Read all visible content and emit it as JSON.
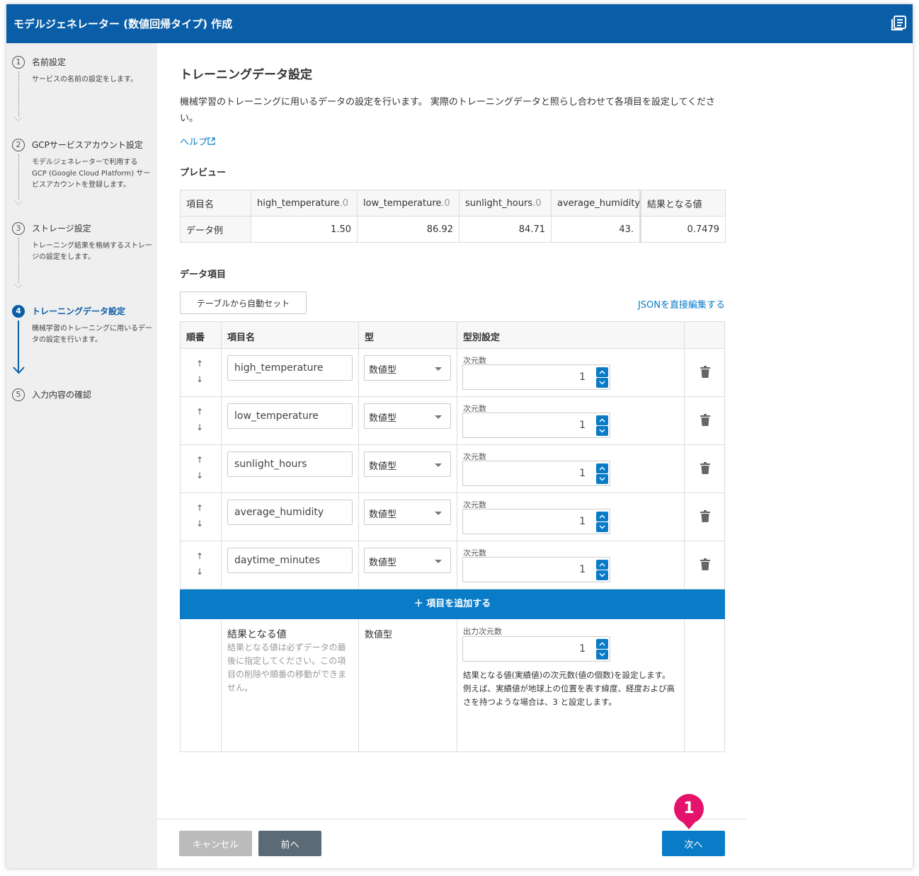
{
  "window": {
    "title": "モデルジェネレーター (数値回帰タイプ) 作成",
    "title_icon": "book-list-icon"
  },
  "sidebar": {
    "steps": [
      {
        "num": "1",
        "label": "名前設定",
        "desc": "サービスの名前の設定をします。",
        "state": "done"
      },
      {
        "num": "2",
        "label": "GCPサービスアカウント設定",
        "desc": "モデルジェネレーターで利用する GCP (Google Cloud Platform) サービスアカウントを登録します。",
        "state": "done"
      },
      {
        "num": "3",
        "label": "ストレージ設定",
        "desc": "トレーニング結果を格納するストレージの設定をします。",
        "state": "done"
      },
      {
        "num": "4",
        "label": "トレーニングデータ設定",
        "desc": "機械学習のトレーニングに用いるデータの設定を行います。",
        "state": "active"
      },
      {
        "num": "5",
        "label": "入力内容の確認",
        "desc": "",
        "state": "todo"
      }
    ]
  },
  "main": {
    "title": "トレーニングデータ設定",
    "intro": "機械学習のトレーニングに用いるデータの設定を行います。 実際のトレーニングデータと照らし合わせて各項目を設定してください。",
    "help_label": "ヘルプ",
    "preview_heading": "プレビュー",
    "preview": {
      "header_label": "項目名",
      "columns": [
        {
          "name": "high_temperature",
          "suffix": ".0"
        },
        {
          "name": "low_temperature",
          "suffix": ".0"
        },
        {
          "name": "sunlight_hours",
          "suffix": ".0"
        },
        {
          "name": "average_humidity",
          "suffix": ""
        },
        {
          "name": "結果となる値",
          "suffix": ""
        }
      ],
      "row_label": "データ例",
      "values": [
        "1.50",
        "86.92",
        "84.71",
        "43.",
        "0.7479"
      ]
    },
    "data_items_heading": "データ項目",
    "auto_set_label": "テーブルから自動セット",
    "json_edit_label": "JSONを直接編集する",
    "table": {
      "headers": {
        "order": "順番",
        "name": "項目名",
        "type": "型",
        "type_settings": "型別設定"
      },
      "dim_label": "次元数",
      "rows": [
        {
          "name": "high_temperature",
          "type": "数値型",
          "dim": "1"
        },
        {
          "name": "low_temperature",
          "type": "数値型",
          "dim": "1"
        },
        {
          "name": "sunlight_hours",
          "type": "数値型",
          "dim": "1"
        },
        {
          "name": "average_humidity",
          "type": "数値型",
          "dim": "1"
        },
        {
          "name": "daytime_minutes",
          "type": "数値型",
          "dim": "1"
        }
      ],
      "add_label": "＋ 項目を追加する",
      "result": {
        "title": "結果となる値",
        "desc": "結果となる値は必ずデータの最後に指定してください。この項目の削除や順番の移動ができません。",
        "type": "数値型",
        "out_dim_label": "出力次元数",
        "out_dim": "1",
        "note_1": "結果となる値(実績値)の次元数(値の個数)を設定します。",
        "note_2": "例えば、実績値が地球上の位置を表す緯度、経度および高さを持つような場合は、3 と設定します。"
      }
    },
    "buttons": {
      "cancel": "キャンセル",
      "prev": "前へ",
      "next": "次へ"
    },
    "callout": "1"
  },
  "colors": {
    "header": "#0a5ea8",
    "accent": "#0a7cc7",
    "callout": "#e4126b"
  }
}
